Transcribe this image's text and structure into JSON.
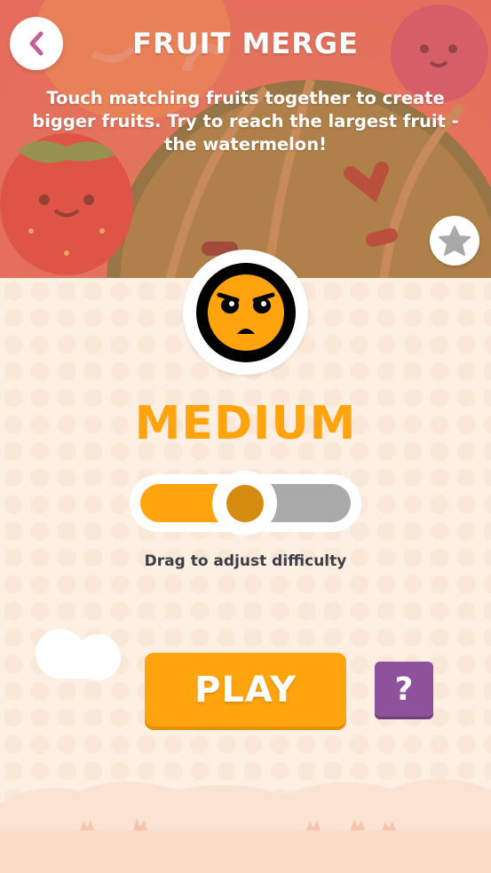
{
  "header": {
    "title": "FRUIT MERGE",
    "description": "Touch matching fruits together to create bigger fruits. Try to reach the largest fruit - the watermelon!",
    "back_icon": "back-arrow-icon",
    "favorite_icon": "star-icon"
  },
  "difficulty": {
    "label": "MEDIUM",
    "emblem_icon": "angry-face-icon",
    "level": 0.5,
    "hint": "Drag to adjust difficulty"
  },
  "actions": {
    "play_label": "PLAY",
    "help_label": "?"
  },
  "colors": {
    "accent_orange": "#ffa30f",
    "thumb": "#d48b0e",
    "help_purple": "#8e529c",
    "header_red": "#e46a5a",
    "background": "#fdefe2"
  }
}
